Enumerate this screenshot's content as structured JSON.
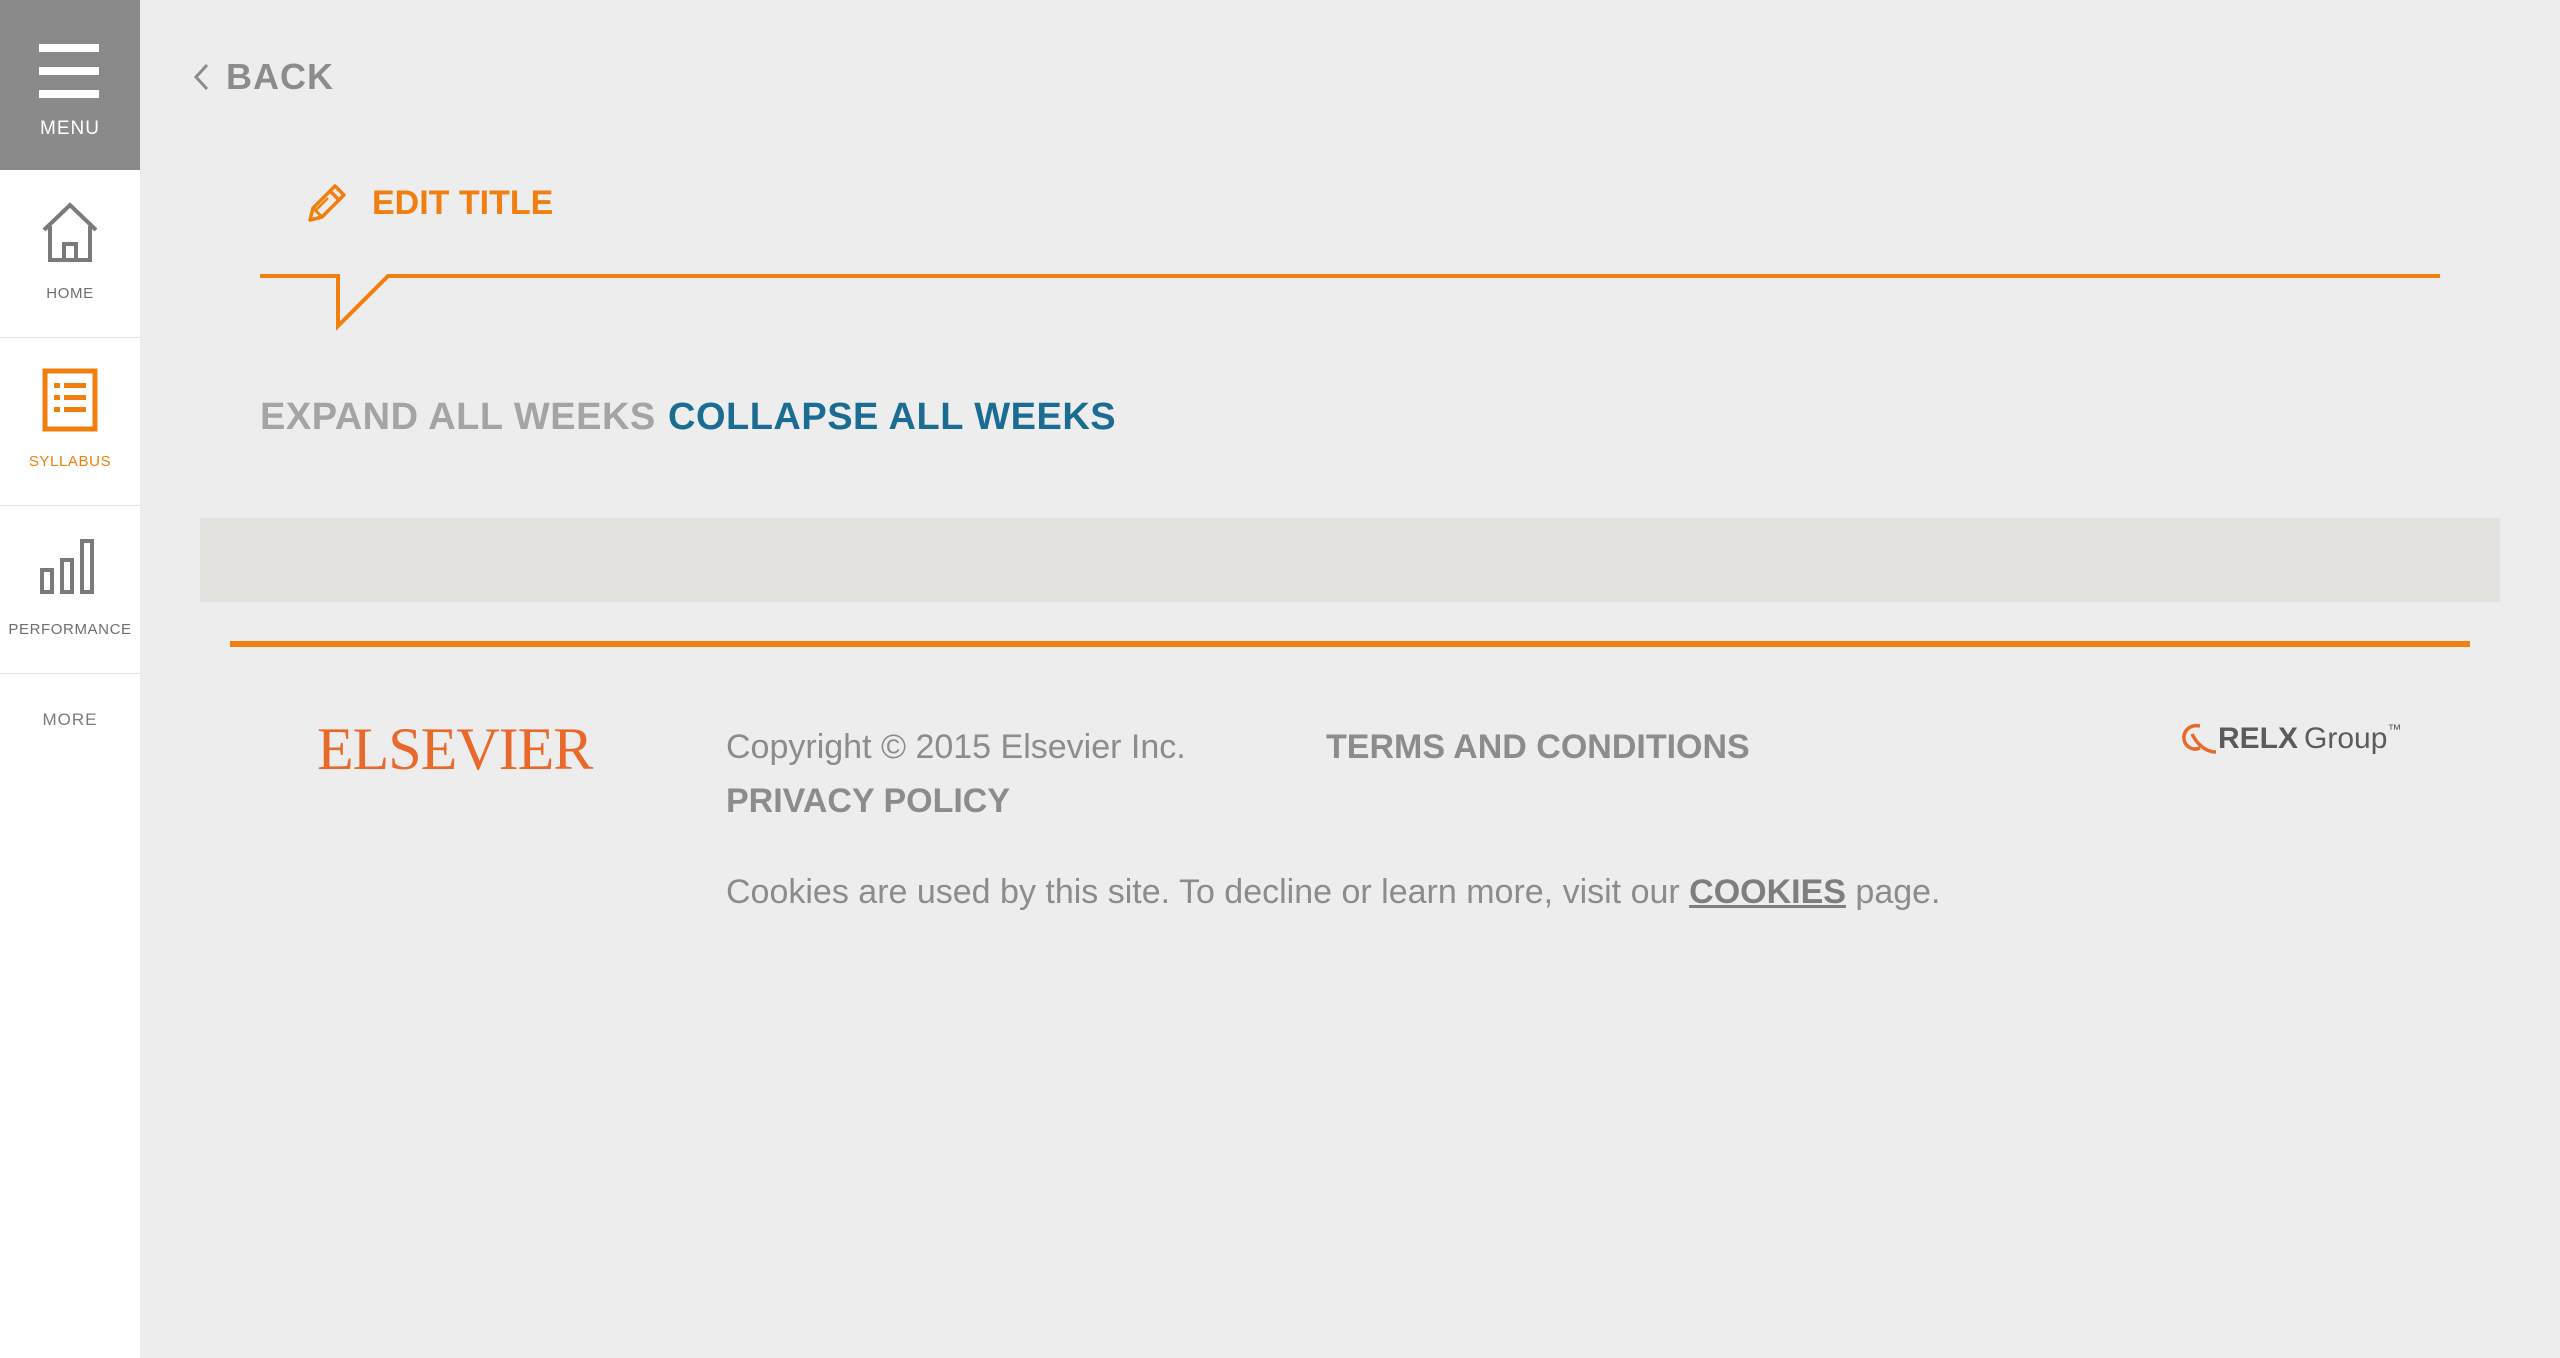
{
  "colors": {
    "accent": "#f07f0f",
    "link_blue": "#1a6c93",
    "muted_text": "#8c8c8c",
    "sidebar_menu_bg": "#8a8a8a",
    "page_bg": "#ededed"
  },
  "sidebar": {
    "menu_label": "MENU",
    "items": [
      {
        "label": "HOME",
        "icon": "home-icon"
      },
      {
        "label": "SYLLABUS",
        "icon": "syllabus-icon",
        "active": true
      },
      {
        "label": "PERFORMANCE",
        "icon": "bar-chart-icon"
      }
    ],
    "more_label": "MORE"
  },
  "main": {
    "back_label": "BACK",
    "edit_title_label": "EDIT TITLE",
    "expand_all_label": "EXPAND ALL WEEKS",
    "collapse_all_label": "COLLAPSE ALL WEEKS"
  },
  "footer": {
    "logo_text": "ELSEVIER",
    "copyright": "Copyright © 2015 Elsevier Inc.",
    "terms_label": "TERMS AND CONDITIONS",
    "privacy_label": "PRIVACY POLICY",
    "relx_bold": "RELX",
    "relx_light": "Group",
    "relx_tm": "™",
    "cookies_prefix": "Cookies are used by this site. To decline or learn more, visit our ",
    "cookies_link": "COOKIES",
    "cookies_suffix": " page."
  }
}
